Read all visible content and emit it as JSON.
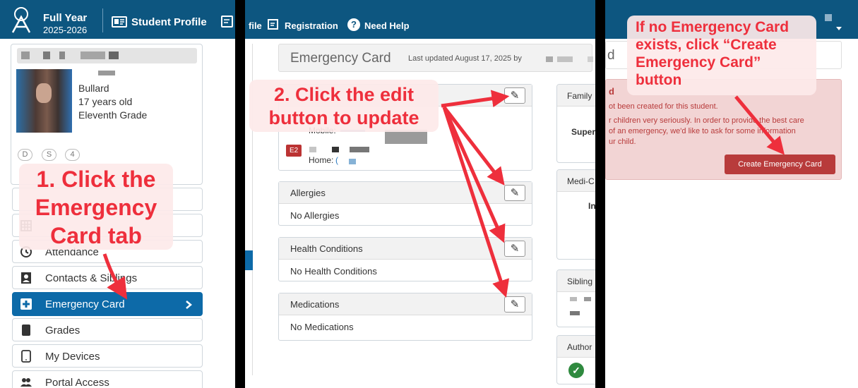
{
  "panel1": {
    "term_title": "Full Year",
    "term_years": "2025-2026",
    "student_profile_label": "Student Profile",
    "student": {
      "last_name": "Bullard",
      "age": "17 years old",
      "grade": "Eleventh Grade",
      "badges": [
        "D",
        "S",
        "4"
      ]
    },
    "nav": [
      {
        "label": "Attendance",
        "icon": "clock-icon"
      },
      {
        "label": "Contacts & Siblings",
        "icon": "contact-card-icon"
      },
      {
        "label": "Emergency Card",
        "icon": "medical-cross-icon",
        "active": true
      },
      {
        "label": "Grades",
        "icon": "book-icon"
      },
      {
        "label": "My Devices",
        "icon": "tablet-icon"
      },
      {
        "label": "Portal Access",
        "icon": "users-icon"
      }
    ],
    "callout": [
      "1. Click the",
      "Emergency",
      "Card tab"
    ]
  },
  "panel2": {
    "topbar": {
      "profile_fragment": "file",
      "registration_label": "Registration",
      "help_label": "Need Help"
    },
    "page_title": "Emergency Card",
    "last_updated": "Last updated August 17, 2025 by",
    "contact": {
      "mobile_label": "Mobile:",
      "home_label": "Home:",
      "home_paren": "(",
      "badge": "E2"
    },
    "sections": [
      {
        "title": "Allergies",
        "value": "No Allergies"
      },
      {
        "title": "Health Conditions",
        "value": "No Health Conditions"
      },
      {
        "title": "Medications",
        "value": "No Medications"
      }
    ],
    "right_cards": {
      "family": "Family",
      "super": "Super",
      "medi": "Medi-C",
      "in": "In",
      "sibling": "Sibling",
      "author": "Author"
    },
    "callout": [
      "2. Click the edit",
      "button to update"
    ],
    "edit_glyph": "✎"
  },
  "panel3": {
    "search_fragment": "d",
    "alert": {
      "title_fragment": "d",
      "line1": "ot been created for this student.",
      "line2": "r children very seriously. In order to provide the best care",
      "line3": "of an emergency, we'd like to ask for some information",
      "line4": "ur child."
    },
    "create_button": "Create Emergency Card",
    "callout": [
      "If no Emergency Card",
      "exists, click “Create",
      "Emergency Card”",
      "button"
    ]
  },
  "colors": {
    "nav_bar": "#0d5680",
    "active_nav": "#0d6aa8",
    "annotation_red": "#ee2f3c",
    "callout_bg": "#fde9e9",
    "alert_bg": "#f2d4d4",
    "create_button": "#b83b3b"
  }
}
